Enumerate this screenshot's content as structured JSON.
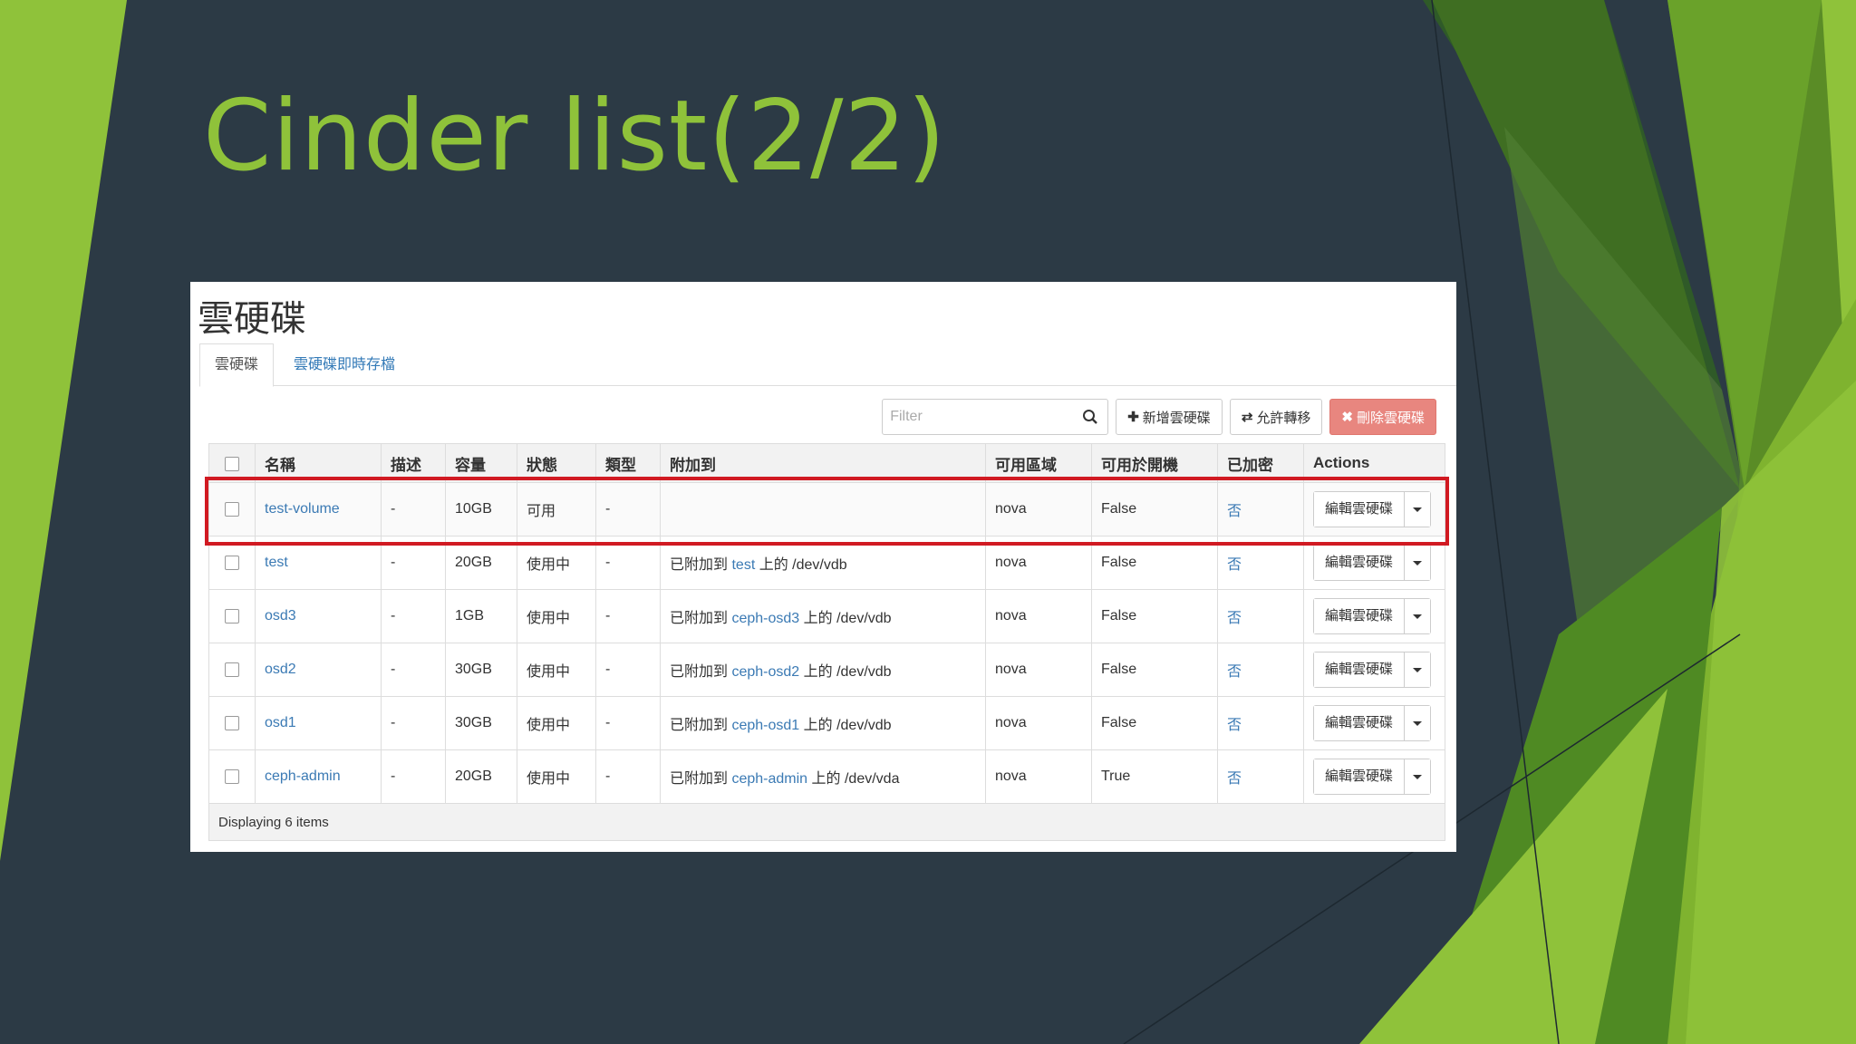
{
  "slide": {
    "title": "Cinder list(2/2)"
  },
  "page": {
    "title": "雲硬碟"
  },
  "tabs": [
    {
      "label": "雲硬碟",
      "active": true
    },
    {
      "label": "雲硬碟即時存檔",
      "active": false
    }
  ],
  "toolbar": {
    "filter_placeholder": "Filter",
    "create_label": "新增雲硬碟",
    "transfer_label": "允許轉移",
    "delete_label": "刪除雲硬碟"
  },
  "table": {
    "headers": [
      "名稱",
      "描述",
      "容量",
      "狀態",
      "類型",
      "附加到",
      "可用區域",
      "可用於開機",
      "已加密",
      "Actions"
    ],
    "rows": [
      {
        "name": "test-volume",
        "desc": "-",
        "size": "10GB",
        "status": "可用",
        "type": "-",
        "attach_prefix": "",
        "attach_host": "",
        "attach_suffix": "",
        "zone": "nova",
        "bootable": "False",
        "encrypted": "否",
        "action": "編輯雲硬碟"
      },
      {
        "name": "test",
        "desc": "-",
        "size": "20GB",
        "status": "使用中",
        "type": "-",
        "attach_prefix": "已附加到",
        "attach_host": "test",
        "attach_suffix": "上的 /dev/vdb",
        "zone": "nova",
        "bootable": "False",
        "encrypted": "否",
        "action": "編輯雲硬碟"
      },
      {
        "name": "osd3",
        "desc": "-",
        "size": "1GB",
        "status": "使用中",
        "type": "-",
        "attach_prefix": "已附加到",
        "attach_host": "ceph-osd3",
        "attach_suffix": "上的 /dev/vdb",
        "zone": "nova",
        "bootable": "False",
        "encrypted": "否",
        "action": "編輯雲硬碟"
      },
      {
        "name": "osd2",
        "desc": "-",
        "size": "30GB",
        "status": "使用中",
        "type": "-",
        "attach_prefix": "已附加到",
        "attach_host": "ceph-osd2",
        "attach_suffix": "上的 /dev/vdb",
        "zone": "nova",
        "bootable": "False",
        "encrypted": "否",
        "action": "編輯雲硬碟"
      },
      {
        "name": "osd1",
        "desc": "-",
        "size": "30GB",
        "status": "使用中",
        "type": "-",
        "attach_prefix": "已附加到",
        "attach_host": "ceph-osd1",
        "attach_suffix": "上的 /dev/vdb",
        "zone": "nova",
        "bootable": "False",
        "encrypted": "否",
        "action": "編輯雲硬碟"
      },
      {
        "name": "ceph-admin",
        "desc": "-",
        "size": "20GB",
        "status": "使用中",
        "type": "-",
        "attach_prefix": "已附加到",
        "attach_host": "ceph-admin",
        "attach_suffix": "上的 /dev/vda",
        "zone": "nova",
        "bootable": "True",
        "encrypted": "否",
        "action": "編輯雲硬碟"
      }
    ],
    "footer": "Displaying 6 items"
  },
  "colors": {
    "background": "#2c3a45",
    "title": "#8fc23a",
    "highlight": "#d11a22",
    "link": "#3b7ab4"
  }
}
